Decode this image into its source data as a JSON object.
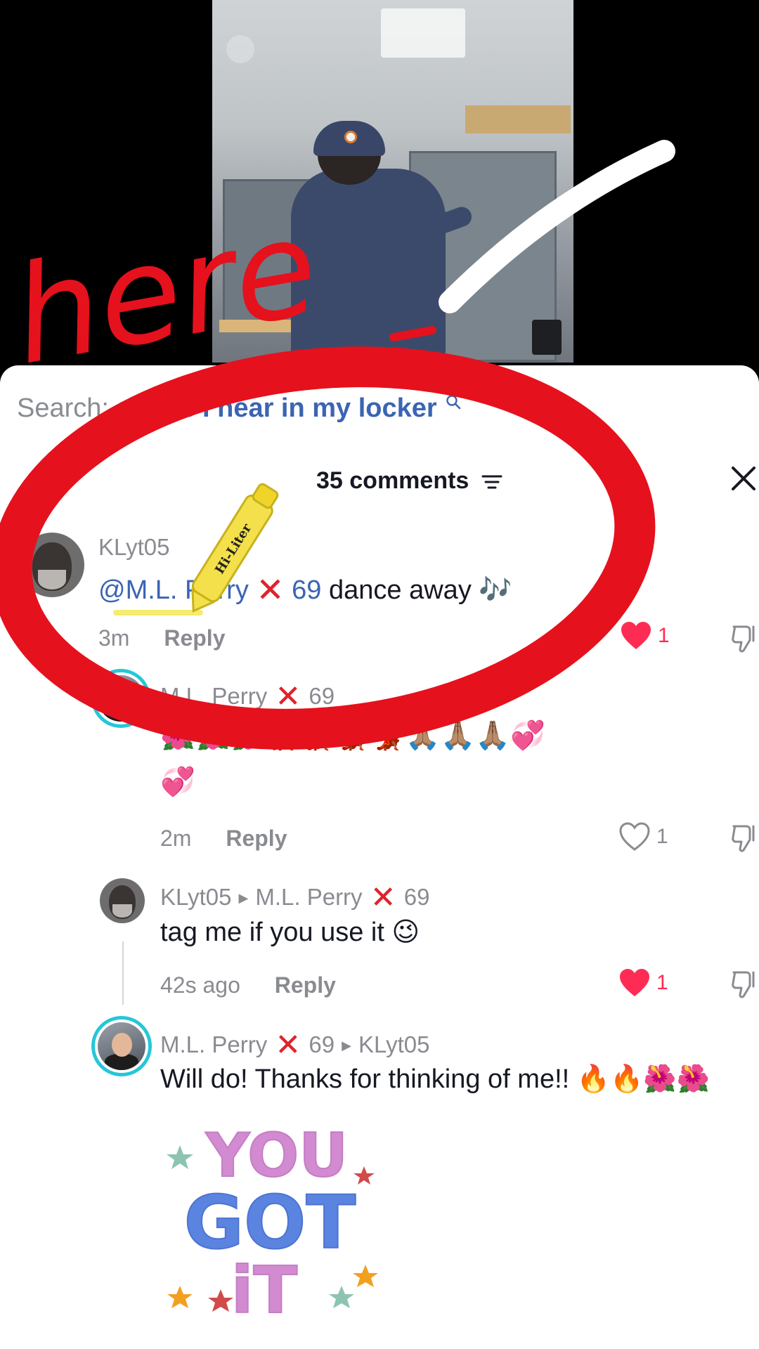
{
  "search": {
    "prefix": "Search:",
    "query": "songs I hear in my locker"
  },
  "header": {
    "comment_count": "35 comments"
  },
  "comments": [
    {
      "username": "KLyt05",
      "mention_name": "@M.L. Perry",
      "mention_suffix": "69",
      "text": "dance away 🎶",
      "time": "3m",
      "reply_label": "Reply",
      "likes": "1",
      "liked": true
    },
    {
      "username": "M.L. Perry",
      "username_suffix": "69",
      "emoji_line_1": "🌺🌺🌺💃🏾💃🏾💃🏾💃🏾🙏🏽🙏🏽🙏🏽💞",
      "emoji_line_2": "💞",
      "time": "2m",
      "reply_label": "Reply",
      "likes": "1",
      "liked": false
    },
    {
      "username": "KLyt05",
      "reply_to": "M.L. Perry",
      "reply_to_suffix": "69",
      "text": "tag me if you use it 😉",
      "time": "42s ago",
      "reply_label": "Reply",
      "likes": "1",
      "liked": true
    },
    {
      "username": "M.L. Perry",
      "username_suffix": "69",
      "reply_to": "KLyt05",
      "text": "Will do! Thanks for thinking of me!! 🔥🔥🌺🌺",
      "sticker_text": [
        "YOU",
        "GOT",
        "iT"
      ]
    }
  ],
  "annotations": {
    "handwritten_word": "here",
    "highlighter_label": "Hi-Liter"
  },
  "colors": {
    "accent_red": "#fe2c55",
    "mention_blue": "#3b64b4",
    "annotation_red": "#e5111d",
    "muted_gray": "#8a8b91"
  }
}
